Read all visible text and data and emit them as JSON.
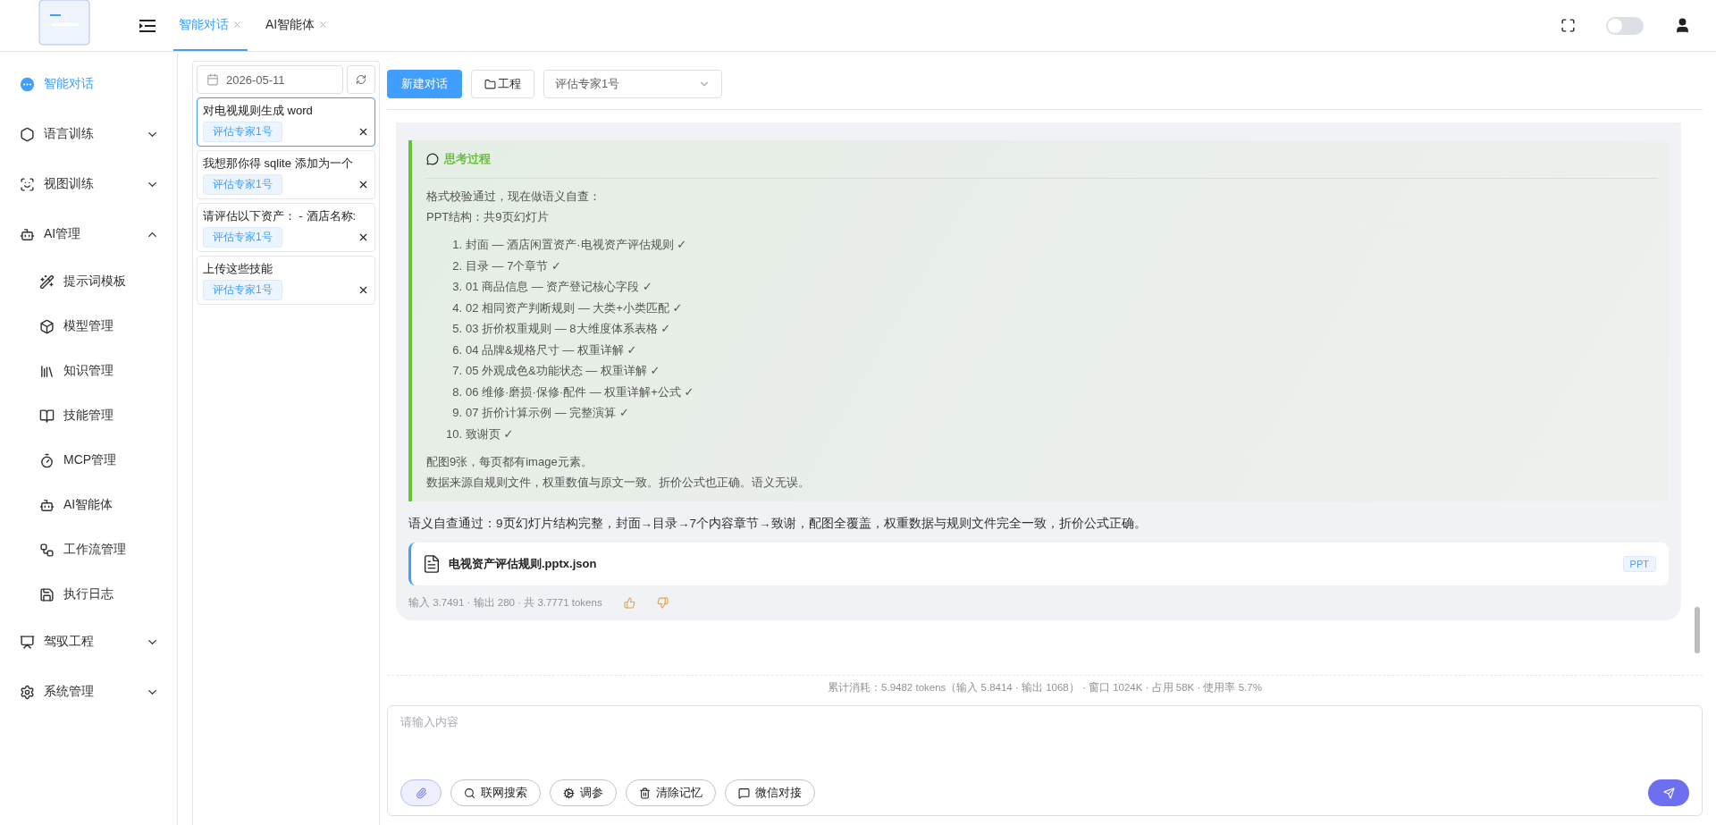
{
  "header": {
    "tabs": [
      {
        "label": "智能对话",
        "selected": true
      },
      {
        "label": "AI智能体",
        "selected": false
      }
    ],
    "theme_switch": {
      "on": false
    }
  },
  "sidebar": {
    "items": [
      {
        "label": "智能对话",
        "selected": true
      },
      {
        "label": "语言训练",
        "selected": false,
        "expanded": false
      },
      {
        "label": "视图训练",
        "selected": false,
        "expanded": false
      },
      {
        "label": "AI管理",
        "selected": false,
        "expanded": true,
        "children": [
          {
            "label": "提示词模板",
            "selected": false
          },
          {
            "label": "模型管理",
            "selected": false
          },
          {
            "label": "知识管理",
            "selected": false
          },
          {
            "label": "技能管理",
            "selected": false
          },
          {
            "label": "MCP管理",
            "selected": false
          },
          {
            "label": "AI智能体",
            "selected": false
          },
          {
            "label": "工作流管理",
            "selected": false
          },
          {
            "label": "执行日志",
            "selected": false
          }
        ]
      },
      {
        "label": "驾驭工程",
        "selected": false,
        "expanded": false
      },
      {
        "label": "系统管理",
        "selected": false,
        "expanded": false
      }
    ]
  },
  "history": {
    "date": "2026-05-11",
    "conversations": [
      {
        "title": "对电视规则生成 word",
        "agent": "评估专家1号",
        "selected": true
      },
      {
        "title": "我想那你得 sqlite 添加为一个",
        "agent": "评估专家1号",
        "selected": false
      },
      {
        "title": "请评估以下资产：  - 酒店名称:",
        "agent": "评估专家1号",
        "selected": false
      },
      {
        "title": "上传这些技能",
        "agent": "评估专家1号",
        "selected": false
      }
    ]
  },
  "toolbar": {
    "new_chat": "新建对话",
    "project": "工程",
    "agent": "评估专家1号"
  },
  "message": {
    "thinking": {
      "title": "思考过程",
      "intro": [
        "格式校验通过，现在做语义自查：",
        "PPT结构：共9页幻灯片"
      ],
      "list": [
        {
          "number": "1.",
          "text": "封面 — 酒店闲置资产·电视资产评估规则 ✓"
        },
        {
          "number": "2.",
          "text": "目录 — 7个章节 ✓"
        },
        {
          "number": "3.",
          "text": "01 商品信息 — 资产登记核心字段 ✓"
        },
        {
          "number": "4.",
          "text": "02 相同资产判断规则 — 大类+小类匹配 ✓"
        },
        {
          "number": "5.",
          "text": "03 折价权重规则 — 8大维度体系表格 ✓"
        },
        {
          "number": "6.",
          "text": "04 品牌&规格尺寸 — 权重详解 ✓"
        },
        {
          "number": "7.",
          "text": "05 外观成色&功能状态 — 权重详解 ✓"
        },
        {
          "number": "8.",
          "text": "06 维修·磨损·保修·配件 — 权重详解+公式 ✓"
        },
        {
          "number": "9.",
          "text": "07 折价计算示例 — 完整演算 ✓"
        },
        {
          "number": "10.",
          "text": "致谢页 ✓"
        }
      ],
      "notes": [
        "配图9张，每页都有image元素。",
        "数据来源自规则文件，权重数值与原文一致。折价公式也正确。语义无误。"
      ]
    },
    "summary": "语义自查通过：9页幻灯片结构完整，封面→目录→7个内容章节→致谢，配图全覆盖，权重数据与规则文件完全一致，折价公式正确。",
    "file": {
      "name": "电视资产评估规则.pptx.json",
      "type": "PPT"
    },
    "meta": "输入 3.7491 · 输出 280 · 共 3.7771 tokens"
  },
  "usage": "累计消耗：5.9482 tokens（输入 5.8414 · 输出 1068） · 窗口 1024K · 占用 58K · 使用率 5.7%",
  "composer": {
    "placeholder": "请输入内容",
    "tools": [
      "联网搜索",
      "调参",
      "清除记忆",
      "微信对接"
    ]
  }
}
